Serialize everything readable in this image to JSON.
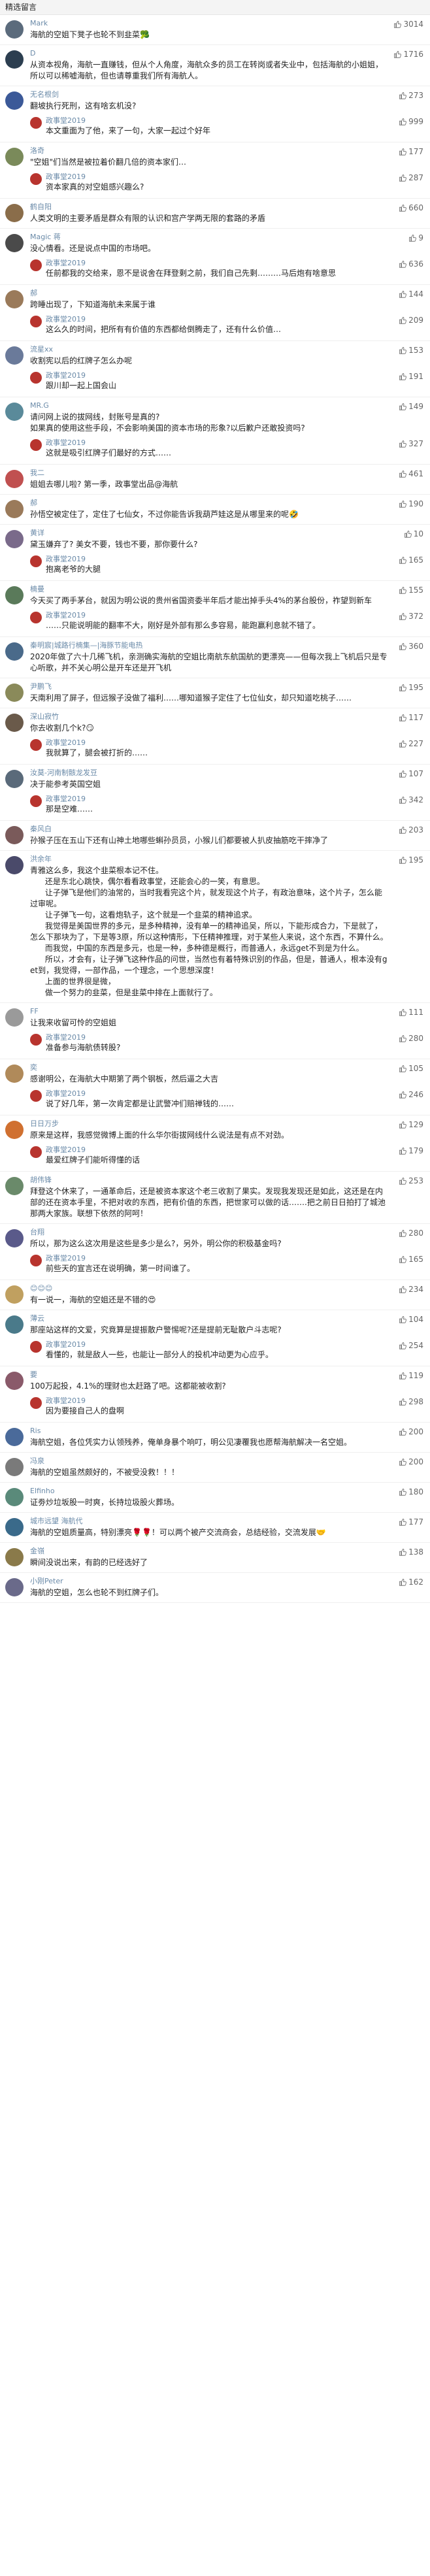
{
  "header": {
    "title": "精选留言"
  },
  "comments": [
    {
      "name": "Mark",
      "likes": "3014",
      "text": "海航的空姐下凳子也轮不到韭菜🥦",
      "avatar_color": "#5b6b7c",
      "replies": []
    },
    {
      "name": "D",
      "likes": "1716",
      "text": "从资本视角，海航一直赚钱，但从个人角度，海航众多的员工在转岗或者失业中，包括海航的小姐姐，所以可以稀嘘海航，但也请尊重我们所有海航人。",
      "avatar_color": "#2c3e50",
      "replies": []
    },
    {
      "name": "无名根剑",
      "likes": "273",
      "text": "翻坡执行死刑，这有啥玄机没?",
      "avatar_color": "#3b5998",
      "replies": [
        {
          "name": "政事堂2019",
          "tag": "作者",
          "likes": "999",
          "text": "本文重面为了他，来了一句，大家一起过个好年",
          "avatar_color": "#b8342e"
        }
      ]
    },
    {
      "name": "洛奇",
      "likes": "177",
      "text": "\"空姐\"们当然是被拉着价翻几倍的资本家们…",
      "avatar_color": "#7a8a5a",
      "replies": [
        {
          "name": "政事堂2019",
          "tag": "作者",
          "likes": "287",
          "text": "资本家真的对空姐感兴趣么?",
          "avatar_color": "#b8342e"
        }
      ]
    },
    {
      "name": "鹤自阳",
      "likes": "660",
      "text": "人类文明的主要矛盾是群众有限的认识和宫产学两无限的套路的矛盾",
      "avatar_color": "#8a6d4a",
      "replies": []
    },
    {
      "name": "Magic 蒋",
      "likes": "9",
      "text": "没心情看。还是说点中国的市场吧。",
      "avatar_color": "#4a4a4a",
      "replies": [
        {
          "name": "政事堂2019",
          "tag": "作者",
          "likes": "636",
          "text": "任前都我的交给来，恩不是说舍在拜登剩之前，我们自己先剩………马后炮有啥意思",
          "avatar_color": "#b8342e"
        }
      ]
    },
    {
      "name": "郝",
      "likes": "144",
      "text": "跨睡出现了，下知道海航未来属于谁",
      "avatar_color": "#9a7a5a",
      "replies": [
        {
          "name": "政事堂2019",
          "tag": "作者",
          "likes": "209",
          "text": "这么久的时间，把所有有价值的东西都给倒腾走了，还有什么价值…",
          "avatar_color": "#b8342e"
        }
      ]
    },
    {
      "name": "流星xx",
      "likes": "153",
      "text": "收割宪以后的红牌子怎么办呢",
      "avatar_color": "#6a7a9a",
      "replies": [
        {
          "name": "政事堂2019",
          "tag": "作者",
          "likes": "191",
          "text": "跟川却一起上国会山",
          "avatar_color": "#b8342e"
        }
      ]
    },
    {
      "name": "MR.G",
      "likes": "149",
      "text": "请问网上说的拔网线，封账号是真的?\n如果真的使用这些手段，不会影响美国的资本市场的形象?以后歉户还敢投资吗?",
      "avatar_color": "#5a8a9a",
      "replies": [
        {
          "name": "政事堂2019",
          "tag": "作者",
          "likes": "327",
          "text": "这就是吸引红牌子们最好的方式……",
          "avatar_color": "#b8342e"
        }
      ]
    },
    {
      "name": "我二",
      "likes": "461",
      "text": "姐姐去哪儿啦? 第一季，政事堂出品@海航",
      "avatar_color": "#c05050",
      "replies": []
    },
    {
      "name": "郝",
      "likes": "190",
      "text": "孙悟空被定住了，定住了七仙女，不过你能告诉我葫芦娃这是从哪里来的呢🤣",
      "avatar_color": "#9a7a5a",
      "replies": []
    },
    {
      "name": "黄详",
      "likes": "10",
      "text": "黛玉嫌弃了? 美女不要，钱也不要，那你要什么?",
      "avatar_color": "#7a6a8a",
      "replies": [
        {
          "name": "政事堂2019",
          "tag": "作者",
          "likes": "165",
          "text": "抱离老爷的大腿",
          "avatar_color": "#b8342e"
        }
      ]
    },
    {
      "name": "楠曼",
      "likes": "155",
      "text": "今天买了两手茅台，就因为明公说的贵州省国资委半年后才能出掉手头4%的茅台股份，祚望到新车",
      "avatar_color": "#5a7a5a",
      "replies": [
        {
          "name": "政事堂2019",
          "tag": "作者",
          "likes": "372",
          "text": "……只能说明能的翻率不大，刚好是外部有那么多容易，能跑赢利息就不错了。",
          "avatar_color": "#b8342e"
        }
      ]
    },
    {
      "name": "秦明宸|城路行楠集—|海豚节能电热",
      "likes": "360",
      "text": "2020年做了六十几稀飞机，亲测确实海航的空姐比南航东航国航的更漂亮——但每次我上飞机后只是专心听歌，并不关心明公是开车还是开飞机",
      "avatar_color": "#4a6a8a",
      "replies": []
    },
    {
      "name": "尹鹏飞",
      "likes": "195",
      "text": "天南利用了屏子，但远猴子没做了福利……哪知道猴子定住了七位仙女，却只知道吃桃子……",
      "avatar_color": "#8a8a5a",
      "replies": []
    },
    {
      "name": "深山寂竹",
      "likes": "117",
      "text": "你去收割几个k?😏",
      "avatar_color": "#6a5a4a",
      "replies": [
        {
          "name": "政事堂2019",
          "tag": "作者",
          "likes": "227",
          "text": "我就算了，腿会被打折的……",
          "avatar_color": "#b8342e"
        }
      ]
    },
    {
      "name": "汝莫-河南制骸龙发豆",
      "likes": "107",
      "text": "决于能参考英国空姐",
      "avatar_color": "#5a6a7a",
      "replies": [
        {
          "name": "政事堂2019",
          "tag": "作者",
          "likes": "342",
          "text": "那是空难……",
          "avatar_color": "#b8342e"
        }
      ]
    },
    {
      "name": "秦风白",
      "likes": "203",
      "text": "孙猴子压在五山下还有山神土地哪些蝌孙员员，小猴儿们都要被人扒皮抽筋吃干摔净了",
      "avatar_color": "#7a5a5a",
      "replies": []
    },
    {
      "name": "洪余年",
      "likes": "195",
      "text": "青雅这么多，我这个韭菜根本记不住。\n      还是东北心跳快，偶尔看看政事堂，还能会心的一笑，有意思。\n      让子弹飞是他们的油常的，当时我看完这个片，就发现这个片子，有政治意味，这个片子，怎么能过审呢。\n      让子弹飞一句，这看炮轨子，这个就是一个韭菜的精神追求。\n      我觉得是美国世界的多元，是多种精神，没有单一的精神追吴，所以，下能形成合力，下是就了，怎么下那块为了，下是等3原，所以这种情形，下任精神推理，对于某些人来说，这个东西，不算什么。\n      而我觉，中国的东西是多元，也是一种，多种德是概行，而普通人，永远get不到是为什么。\n      所以，才会有，让子弹飞这种作品的问世，当然也有着特殊识别的作品，但是，普通人，根本没有get到，我觉得，一部作品，一个理念，一个思想深度！\n      上面的世界很是微，\n      做一个努力的韭菜，但是韭菜中排在上面就行了。",
      "avatar_color": "#4a4a6a",
      "replies": []
    },
    {
      "name": "FF",
      "likes": "111",
      "text": "让我来收留可怜的空姐姐",
      "avatar_color": "#9a9a9a",
      "replies": [
        {
          "name": "政事堂2019",
          "tag": "作者",
          "likes": "280",
          "text": "准备参与海航债转股?",
          "avatar_color": "#b8342e"
        }
      ]
    },
    {
      "name": "奕",
      "likes": "105",
      "text": "感谢明公，在海航大中期第了两个钢板，然后逼之大吉",
      "avatar_color": "#b08a5a",
      "replies": [
        {
          "name": "政事堂2019",
          "tag": "作者",
          "likes": "246",
          "text": "说了好几年，第一次肯定都是让武警冲们赔禅钱的……",
          "avatar_color": "#b8342e"
        }
      ]
    },
    {
      "name": "日日万步",
      "likes": "129",
      "text": "原来是这样，我感觉微博上面的什么华尔街拔网线什么说法是有点不对劲。",
      "avatar_color": "#d07030",
      "replies": [
        {
          "name": "政事堂2019",
          "tag": "作者",
          "likes": "179",
          "text": "最爱红牌子们能听得懂的话",
          "avatar_color": "#b8342e"
        }
      ]
    },
    {
      "name": "胡伟锋",
      "likes": "253",
      "text": "拜登这个休来了，一通革命后，还是被资本家这个老三收割了果实。发现我发现还是如此，这还是在内部的还在资本手里，不把对收的东西，把有价值的东西，把世家可以做的话…….把之前日日拍打了城池那两大家族。联想下依然的阿呵！",
      "avatar_color": "#6a8a6a",
      "replies": []
    },
    {
      "name": "台翔",
      "likes": "280",
      "text": "所以，那为这么这次用是这些是多少是么?，另外，明公你的积极基金吗?",
      "avatar_color": "#5a5a8a",
      "replies": [
        {
          "name": "政事堂2019",
          "tag": "作者",
          "likes": "165",
          "text": "前些天的宣言还在说明确，第一时间谁了。",
          "avatar_color": "#b8342e"
        }
      ]
    },
    {
      "name": "😊😊😊",
      "likes": "234",
      "text": "有一说一，海航的空姐还是不错的😍",
      "avatar_color": "#c0a060",
      "replies": []
    },
    {
      "name": "薄云",
      "likes": "104",
      "text": "那座站这样的文爱，究竟算是提振散户警惕呢?还是提前无耻散户斗志呢?",
      "avatar_color": "#4a7a8a",
      "replies": [
        {
          "name": "政事堂2019",
          "tag": "作者",
          "likes": "254",
          "text": "看懂的，就是敌人一些，也能让一部分人的投机冲动更为心应乎。",
          "avatar_color": "#b8342e"
        }
      ]
    },
    {
      "name": "要",
      "likes": "119",
      "text": "100万起投，4.1%的理财也太赶路了吧。这都能被收割?",
      "avatar_color": "#8a5a6a",
      "replies": [
        {
          "name": "政事堂2019",
          "tag": "作者",
          "likes": "298",
          "text": "因为要接自己人的盘啊",
          "avatar_color": "#b8342e"
        }
      ]
    },
    {
      "name": "Ris",
      "likes": "200",
      "text": "海航空姐，各位凭实力认领残养，俺单身暴个响叮，明公见凄覆我也愿帮海航解决一名空姐。",
      "avatar_color": "#4a6a9a",
      "replies": []
    },
    {
      "name": "冯泉",
      "likes": "200",
      "text": "海航的空姐虽然颇好的，不被受没救！！！",
      "avatar_color": "#7a7a7a",
      "replies": []
    },
    {
      "name": "Elfinho",
      "likes": "180",
      "text": "证劵炒垃坂股一时爽，长持垃圾股火葬场。",
      "avatar_color": "#5a8a7a",
      "replies": []
    },
    {
      "name": "城市远望 海航代",
      "likes": "177",
      "text": "海航的空姐质量高，特别漂亮🌹🌹！可以两个被产交流商会，总结经验，交流发展🤝",
      "avatar_color": "#3a6a8a",
      "replies": []
    },
    {
      "name": "金嶺",
      "likes": "138",
      "text": "瞬间没说出来，有韵的已经选好了",
      "avatar_color": "#8a7a4a",
      "replies": []
    },
    {
      "name": "小刚Peter",
      "likes": "162",
      "text": "海航的空姐，怎么也轮不到红牌子们。",
      "avatar_color": "#6a6a8a",
      "replies": []
    }
  ]
}
